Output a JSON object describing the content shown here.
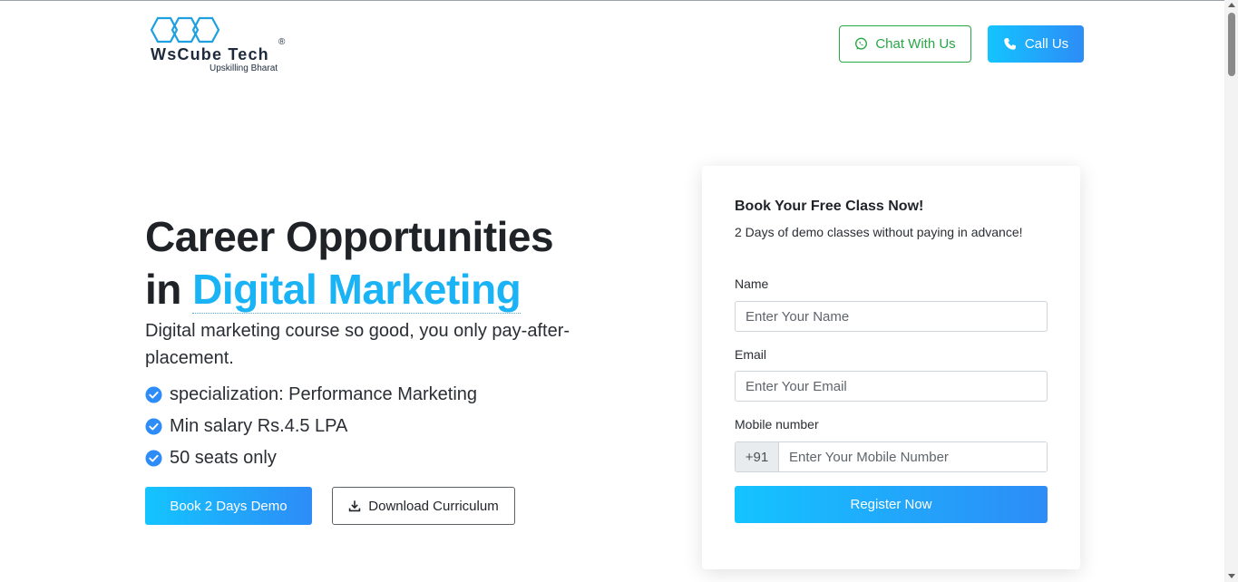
{
  "header": {
    "logo_text": "WsCube Tech",
    "logo_reg": "®",
    "logo_tagline": "Upskilling Bharat",
    "chat_button": "Chat With Us",
    "call_button": "Call Us"
  },
  "hero": {
    "title_line1": "Career Opportunities",
    "title_line2_prefix": "in ",
    "title_accent": "Digital Marketing",
    "subtitle": "Digital marketing course so good, you only pay-after-placement.",
    "features": [
      "specialization: Performance Marketing",
      "Min salary Rs.4.5 LPA",
      "50 seats only"
    ],
    "demo_button": "Book 2 Days Demo",
    "download_button": "Download Curriculum"
  },
  "form": {
    "title": "Book Your Free Class Now!",
    "subtitle": "2 Days of demo classes without paying in advance!",
    "name_label": "Name",
    "name_placeholder": "Enter Your Name",
    "email_label": "Email",
    "email_placeholder": "Enter Your Email",
    "mobile_label": "Mobile number",
    "mobile_prefix": "+91",
    "mobile_placeholder": "Enter Your Mobile Number",
    "submit_button": "Register Now"
  },
  "colors": {
    "accent": "#1ab3f5",
    "gradient_start": "#14c4ff",
    "gradient_end": "#2d8cf7",
    "chat_green": "#28a745",
    "logo_blue": "#1ea0e0"
  },
  "icons": {
    "chat": "whatsapp-icon",
    "call": "phone-icon",
    "feature": "check-circle-icon",
    "download": "download-icon"
  }
}
